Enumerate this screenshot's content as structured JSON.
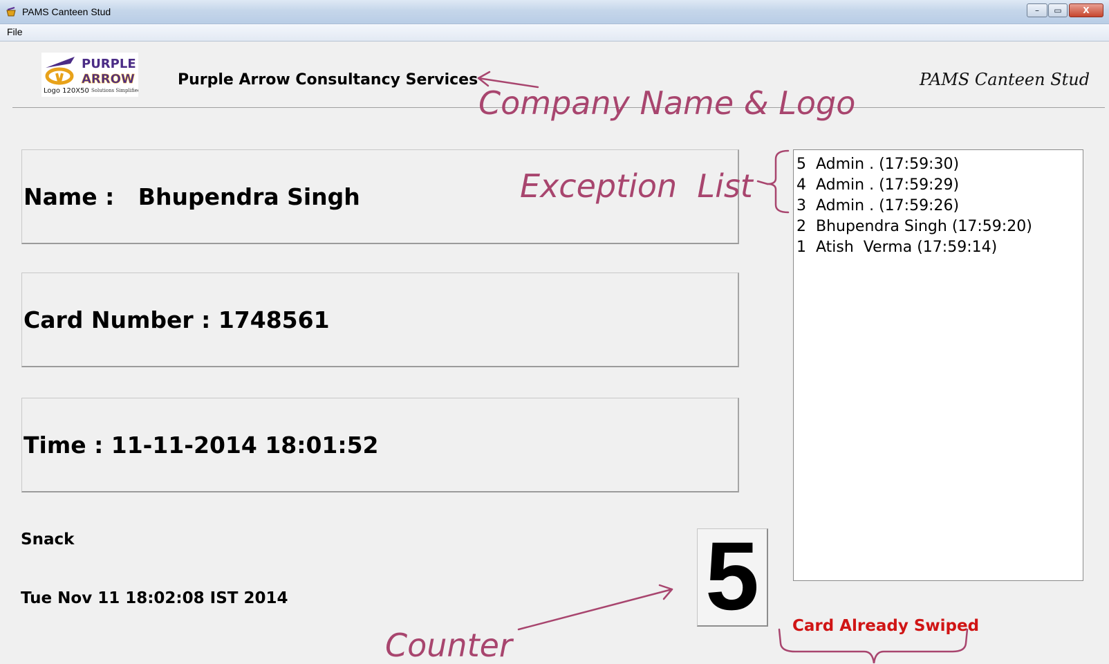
{
  "window": {
    "title": "PAMS Canteen Stud",
    "controls": {
      "minimize": "–",
      "maximize": "▭",
      "close": "X"
    }
  },
  "menu": {
    "items": [
      "File"
    ]
  },
  "header": {
    "logo_line1": "PURPLE",
    "logo_line2": "ARROW",
    "logo_caption": "Logo 120X50",
    "logo_tagline": "Solutions Simplified",
    "company_name": "Purple Arrow Consultancy Services",
    "app_name": "PAMS Canteen Stud"
  },
  "employee": {
    "name_text": "Name :   Bhupendra Singh",
    "card_text": "Card Number : 1748561",
    "time_text": "Time : 11-11-2014 18:01:52"
  },
  "meal": {
    "label": "Snack"
  },
  "clock": {
    "datetime": "Tue Nov 11 18:02:08 IST 2014"
  },
  "counter": {
    "value": "5"
  },
  "status": {
    "message": "Card Already Swiped",
    "color": "#d01515"
  },
  "exception_list": {
    "items": [
      "5  Admin . (17:59:30)",
      "4  Admin . (17:59:29)",
      "3  Admin . (17:59:26)",
      "2  Bhupendra Singh (17:59:20)",
      "1  Atish  Verma (17:59:14)"
    ]
  },
  "annotations": {
    "company": "Company Name & Logo",
    "exception": "Exception  List",
    "counter": "Counter",
    "color": "#a8456e"
  }
}
